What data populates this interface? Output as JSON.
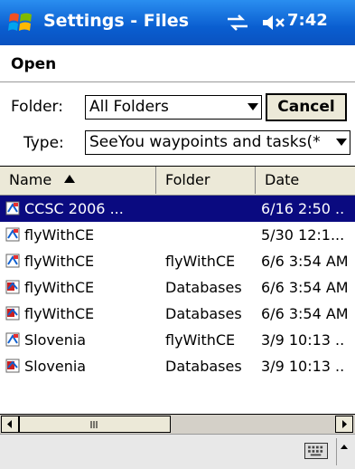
{
  "titlebar": {
    "title": "Settings - Files",
    "time": "7:42",
    "connectivity_icon": "connectivity-icon",
    "volume_icon": "speaker-muted-icon"
  },
  "menu": {
    "open_label": "Open"
  },
  "form": {
    "folder_label": "Folder:",
    "folder_value": "All Folders",
    "cancel_label": "Cancel",
    "type_label": "Type:",
    "type_value": "SeeYou waypoints and tasks(*"
  },
  "list": {
    "headers": [
      "Name",
      "Folder",
      "Date"
    ],
    "rows": [
      {
        "name": "CCSC 2006 ...",
        "folder": "",
        "date": "6/16 2:50 ..",
        "icon": "waypoint-file-icon",
        "selected": true
      },
      {
        "name": "flyWithCE",
        "folder": "",
        "date": "5/30 12:1...",
        "icon": "waypoint-file-icon",
        "selected": false
      },
      {
        "name": "flyWithCE",
        "folder": "flyWithCE",
        "date": "6/6 3:54 AM",
        "icon": "waypoint-file-icon",
        "selected": false
      },
      {
        "name": "flyWithCE",
        "folder": "Databases",
        "date": "6/6 3:54 AM",
        "icon": "database-file-icon",
        "selected": false
      },
      {
        "name": "flyWithCE",
        "folder": "Databases",
        "date": "6/6 3:54 AM",
        "icon": "database-file-icon",
        "selected": false
      },
      {
        "name": "Slovenia",
        "folder": "flyWithCE",
        "date": "3/9 10:13 ..",
        "icon": "waypoint-file-icon",
        "selected": false
      },
      {
        "name": "Slovenia",
        "folder": "Databases",
        "date": "3/9 10:13 ..",
        "icon": "database-file-icon",
        "selected": false
      }
    ]
  },
  "colors": {
    "titlebar": "#0a5ed0",
    "selection": "#0a0a80"
  }
}
